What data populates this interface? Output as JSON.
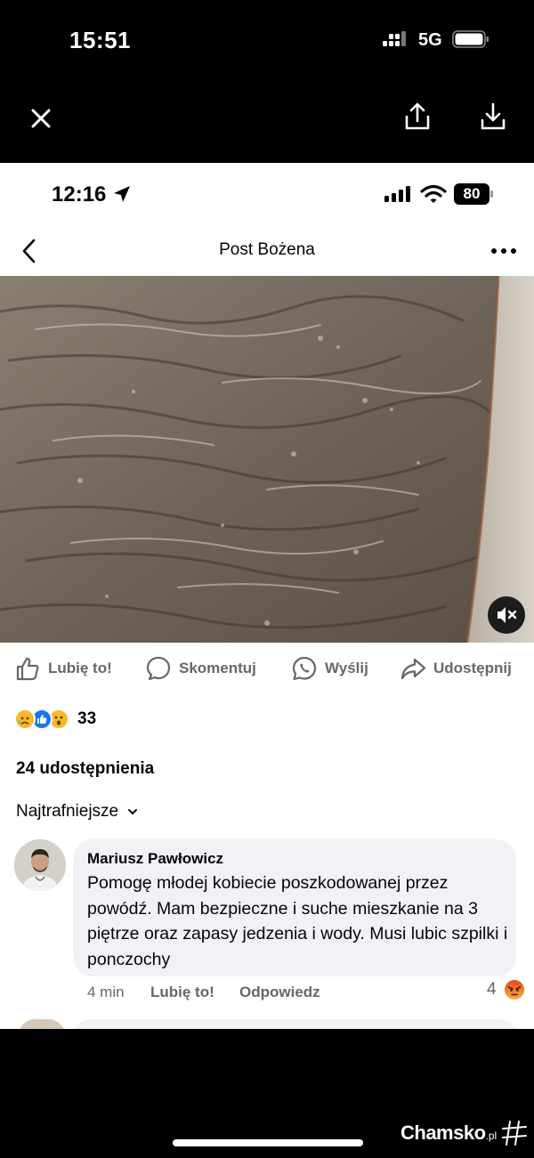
{
  "outer_status": {
    "time": "15:51",
    "network": "5G"
  },
  "viewer": {
    "close_icon": "close-icon",
    "share_icon": "share-icon",
    "download_icon": "download-icon"
  },
  "inner_status": {
    "time": "12:16",
    "battery": "80"
  },
  "header": {
    "title": "Post Bożena"
  },
  "actions": [
    {
      "label": "Lubię to!",
      "icon": "like-icon"
    },
    {
      "label": "Skomentuj",
      "icon": "comment-icon"
    },
    {
      "label": "Wyślij",
      "icon": "whatsapp-icon"
    },
    {
      "label": "Udostępnij",
      "icon": "share-arrow-icon"
    }
  ],
  "reactions": {
    "count": "33",
    "emojis": [
      "sad",
      "like",
      "wow"
    ]
  },
  "shares": "24 udostępnienia",
  "sort": {
    "label": "Najtrafniejsze"
  },
  "comment": {
    "author": "Mariusz Pawłowicz",
    "text": "Pomogę młodej kobiecie poszkodowanej przez powódź. Mam bezpieczne i suche mieszkanie na 3 piętrze oraz zapasy jedzenia i wody. Musi lubic szpilki i ponczochy",
    "time": "4 min",
    "like_label": "Lubię to!",
    "reply_label": "Odpowiedz",
    "reaction_count": "4",
    "reaction": "angry"
  },
  "watermark": {
    "brand": "Chamsko",
    "tld": ".pl"
  },
  "colors": {
    "facebook_blue": "#1877f2",
    "secondary_text": "#65676b",
    "comment_bg": "#f0f2f5",
    "angry": "#f0573c"
  }
}
